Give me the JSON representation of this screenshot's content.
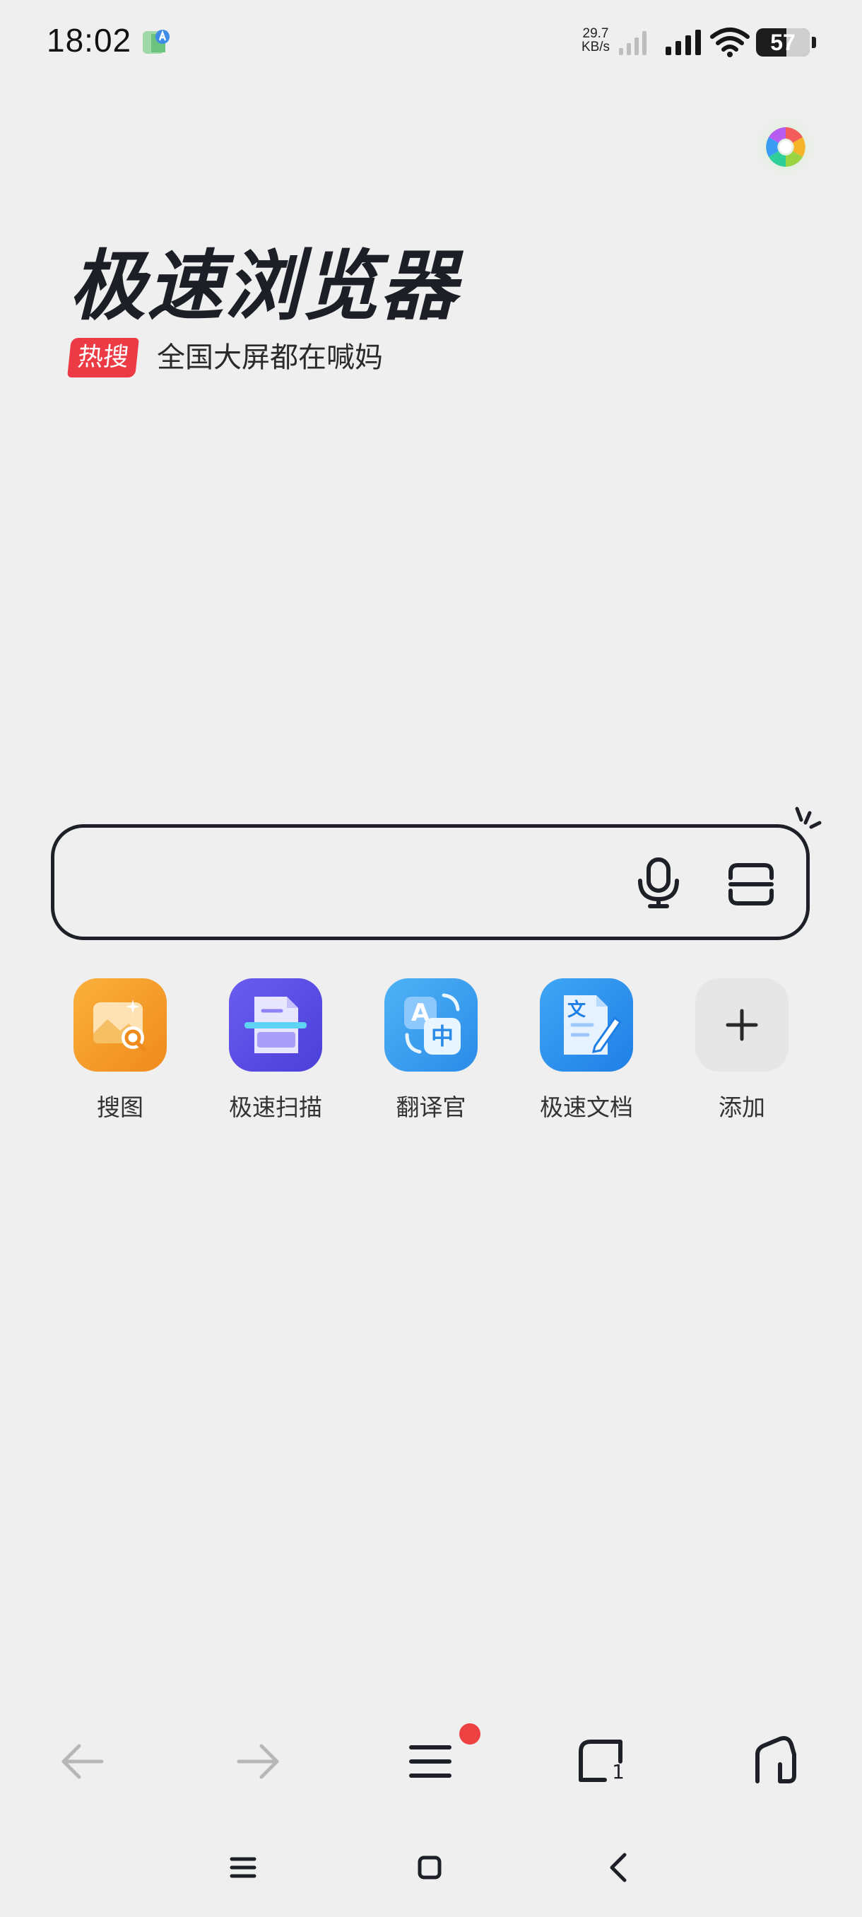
{
  "status_bar": {
    "time": "18:02",
    "net_speed_value": "29.7",
    "net_speed_unit": "KB/s",
    "battery": "57",
    "battery_level": 0.57,
    "icons": [
      "app-notification-icon",
      "signal-weak-icon",
      "signal-strong-icon",
      "wifi-icon",
      "battery-icon"
    ]
  },
  "header": {
    "assistant_icon": "colorful-assistant-icon",
    "brand_title": "极速浏览器",
    "hot_search": {
      "badge": "热搜",
      "text": "全国大屏都在喊妈"
    }
  },
  "search": {
    "placeholder": "",
    "value": "",
    "icons": [
      "microphone-icon",
      "scan-icon",
      "sparkle-icon"
    ]
  },
  "shortcuts": [
    {
      "label": "搜图",
      "icon": "image-search-icon",
      "color": "#f29a2a"
    },
    {
      "label": "极速扫描",
      "icon": "document-scan-icon",
      "color": "#5b4de6"
    },
    {
      "label": "翻译官",
      "icon": "translate-icon",
      "color": "#3d9cf0"
    },
    {
      "label": "极速文档",
      "icon": "document-edit-icon",
      "color": "#2f8ef2"
    },
    {
      "label": "添加",
      "icon": "plus-icon",
      "color": "#e6e6e6"
    }
  ],
  "translate_glyphs": {
    "latin": "A",
    "cjk": "中"
  },
  "doc_glyph": "文",
  "toolbar": {
    "tabs_count": "1",
    "icons": [
      "back-arrow-icon",
      "forward-arrow-icon",
      "menu-icon",
      "tabs-icon",
      "home-icon"
    ]
  },
  "colors": {
    "accent_red": "#ec3b45",
    "text_dark": "#1d1f26",
    "background": "#efefef"
  }
}
